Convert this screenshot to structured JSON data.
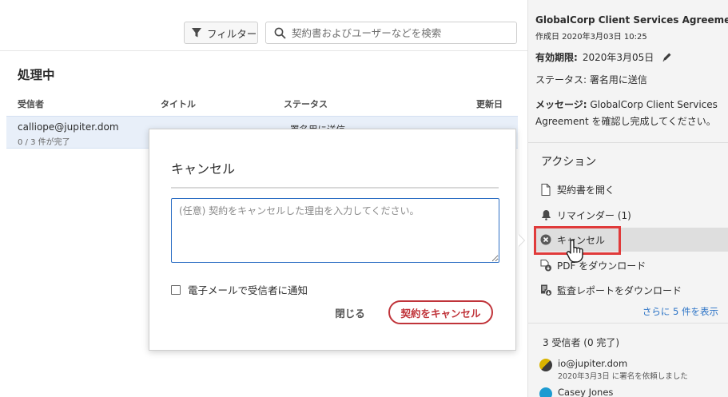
{
  "toolbar": {
    "filter_label": "フィルター",
    "search_placeholder": "契約書およびユーザーなどを検索"
  },
  "list": {
    "section_title": "処理中",
    "columns": [
      "受信者",
      "タイトル",
      "ステータス",
      "更新日"
    ],
    "selected_row": {
      "email": "calliope@jupiter.dom",
      "progress": "0 / 3 件が完了",
      "status_partial": "署名用に送信"
    }
  },
  "dialog": {
    "title": "キャンセル",
    "reason_placeholder": "(任意) 契約をキャンセルした理由を入力してください。",
    "notify_label": "電子メールで受信者に通知",
    "notify_checked": false,
    "close_label": "閉じる",
    "confirm_label": "契約をキャンセル"
  },
  "details": {
    "agreement_title": "GlobalCorp Client Services Agreement",
    "created": "作成日 2020年3月03日 10:25",
    "expiry_label": "有効期限:",
    "expiry_value": "2020年3月05日",
    "status_text": "ステータス: 署名用に送信",
    "message_label": "メッセージ:",
    "message_value": "GlobalCorp Client Services Agreement を確認し完成してください。"
  },
  "actions": {
    "heading": "アクション",
    "items": [
      {
        "label": "契約書を開く",
        "icon": "document-icon"
      },
      {
        "label": "リマインダー (1)",
        "icon": "bell-icon"
      },
      {
        "label": "キャンセル",
        "icon": "cancel-circle-icon"
      },
      {
        "label": "PDF をダウンロード",
        "icon": "pdf-download-icon"
      },
      {
        "label": "監査レポートをダウンロード",
        "icon": "audit-download-icon"
      }
    ],
    "show_more": "さらに 5 件を表示"
  },
  "recipients": {
    "heading": "3 受信者 (0 完了)",
    "items": [
      {
        "name": "io@jupiter.dom",
        "sub": "2020年3月3日 に署名を依頼しました",
        "color": "#d9b400"
      },
      {
        "name": "Casey Jones",
        "sub": "",
        "color": "#1d9bd1"
      }
    ]
  },
  "colors": {
    "accent_blue": "#2b73c6",
    "danger_red": "#c0343a",
    "callout_red": "#e03a3a"
  }
}
